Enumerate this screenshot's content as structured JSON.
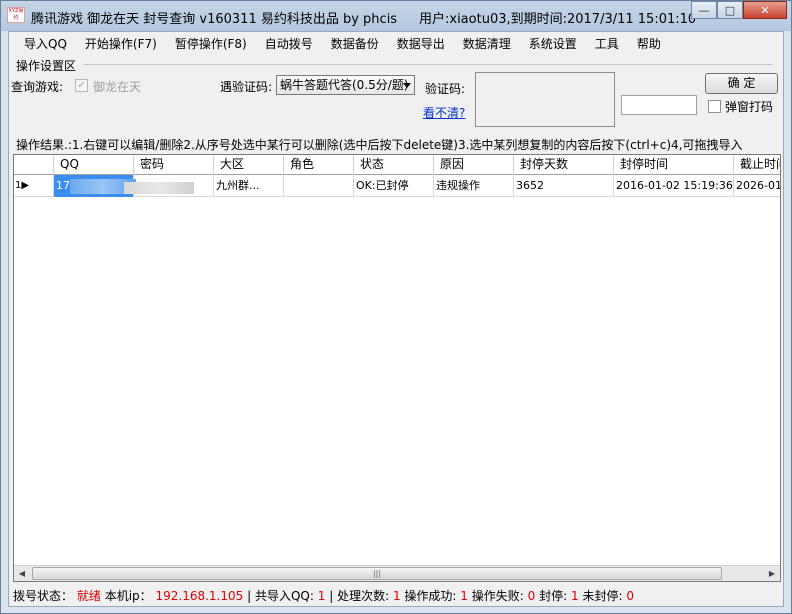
{
  "window": {
    "title": "腾讯游戏 御龙在天 封号查询 v160311   易约科技出品  by phcis",
    "user_info": "用户:xiaotu03,到期时间:2017/3/11 15:01:10",
    "icon_text": "XYZ易约"
  },
  "menu": [
    "导入QQ",
    "开始操作(F7)",
    "暂停操作(F8)",
    "自动拨号",
    "数据备份",
    "数据导出",
    "数据清理",
    "系统设置",
    "工具",
    "帮助"
  ],
  "settings": {
    "group_label": "操作设置区",
    "game_label": "查询游戏:",
    "game_value": "御龙在天",
    "captcha_mode_label": "遇验证码:",
    "captcha_mode_value": "蜗牛答题代答(0.5分/题)",
    "captcha_label": "验证码:",
    "refresh_link": "看不清?",
    "confirm_button": "确 定",
    "popup_label": "弹窗打码"
  },
  "hint": "操作结果.:1.右键可以编辑/删除2.从序号处选中某行可以删除(选中后按下delete键)3.选中某列想复制的内容后按下(ctrl+c)4,可拖拽导入",
  "table": {
    "columns": [
      "QQ",
      "密码",
      "大区",
      "角色",
      "状态",
      "原因",
      "封停天数",
      "封停时间",
      "截止时间"
    ],
    "rows": [
      {
        "index": "1",
        "qq": "17",
        "password": "",
        "region": "九州群...",
        "role": "",
        "status": "OK:已封停",
        "reason": "违规操作",
        "days": "3652",
        "ban_time": "2016-01-02 15:19:36",
        "end_time": "2026-01-"
      }
    ]
  },
  "status": {
    "dial_label": "拨号状态：",
    "dial_value": "就绪",
    "ip_label": "本机ip：",
    "ip_value": "192.168.1.105",
    "sep": "|",
    "total_label": "共导入QQ:",
    "total_value": "1",
    "processed_label": "处理次数:",
    "processed_value": "1",
    "success_label": "操作成功:",
    "success_value": "1",
    "fail_label": "操作失败:",
    "fail_value": "0",
    "banned_label": "封停:",
    "banned_value": "1",
    "unbanned_label": "未封停:",
    "unbanned_value": "0"
  },
  "colors": {
    "selected_cell": "#3a8ef0",
    "status_red": "#e00000",
    "link": "#0033cc"
  }
}
